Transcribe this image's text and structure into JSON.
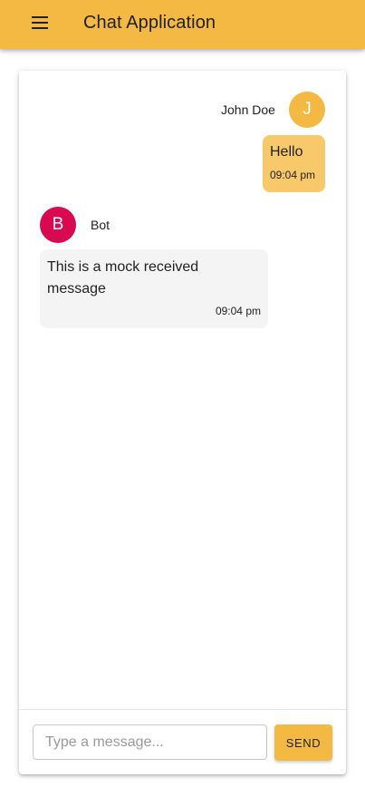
{
  "app_bar": {
    "title": "Chat Application",
    "menu_icon": "menu-icon",
    "color": "#f4b942"
  },
  "messages": [
    {
      "sender": "John Doe",
      "avatar_letter": "J",
      "avatar_color": "#f4b942",
      "text": "Hello",
      "time": "09:04 pm",
      "direction": "sent",
      "bubble_color": "#f7c96a"
    },
    {
      "sender": "Bot",
      "avatar_letter": "B",
      "avatar_color": "#d9094f",
      "text": "This is a mock received message",
      "time": "09:04 pm",
      "direction": "received",
      "bubble_color": "#f4f4f4"
    }
  ],
  "composer": {
    "placeholder": "Type a message...",
    "value": "",
    "send_label": "SEND",
    "send_color": "#f4b942"
  }
}
